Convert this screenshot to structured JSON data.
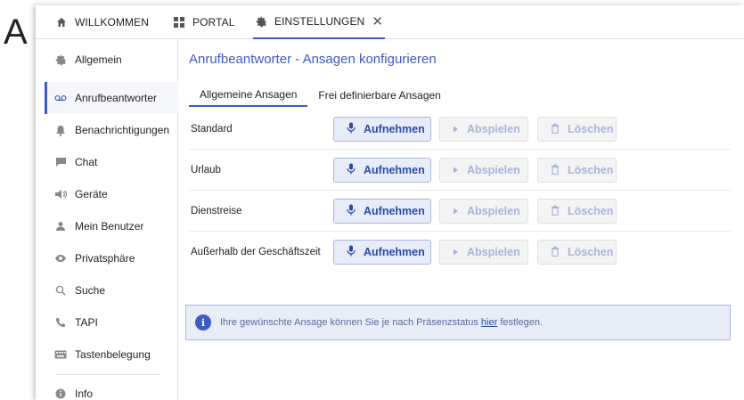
{
  "corner_letter": "A",
  "tabs": [
    {
      "label": "WILLKOMMEN",
      "icon": "home-icon"
    },
    {
      "label": "PORTAL",
      "icon": "grid-icon"
    },
    {
      "label": "EINSTELLUNGEN",
      "icon": "gear-icon",
      "active": true,
      "closable": true
    }
  ],
  "sidebar": {
    "items": [
      {
        "label": "Allgemein",
        "icon": "gear-icon"
      },
      {
        "label": "Anrufbeantworter",
        "icon": "voicemail-icon",
        "active": true
      },
      {
        "label": "Benachrichtigungen",
        "icon": "bell-icon"
      },
      {
        "label": "Chat",
        "icon": "chat-icon"
      },
      {
        "label": "Geräte",
        "icon": "speaker-icon"
      },
      {
        "label": "Mein Benutzer",
        "icon": "user-icon"
      },
      {
        "label": "Privatsphäre",
        "icon": "eye-icon"
      },
      {
        "label": "Suche",
        "icon": "search-icon"
      },
      {
        "label": "TAPI",
        "icon": "phone-icon"
      },
      {
        "label": "Tastenbelegung",
        "icon": "keyboard-icon"
      },
      {
        "label": "Info",
        "icon": "info-icon"
      }
    ]
  },
  "main": {
    "title": "Anrufbeantworter - Ansagen konfigurieren",
    "subtabs": [
      {
        "label": "Allgemeine Ansagen",
        "active": true
      },
      {
        "label": "Frei definierbare Ansagen"
      }
    ],
    "buttons": {
      "record": "Aufnehmen",
      "play": "Abspielen",
      "delete": "Löschen"
    },
    "rows": [
      {
        "label": "Standard"
      },
      {
        "label": "Urlaub"
      },
      {
        "label": "Dienstreise"
      },
      {
        "label": "Außerhalb der Geschäftszeit"
      }
    ],
    "info": {
      "text_before": "Ihre gewünschte Ansage können Sie je nach Präsenzstatus ",
      "link": "hier",
      "text_after": " festlegen."
    }
  },
  "colors": {
    "accent": "#3b5cc4",
    "info_bg": "#e9edf8",
    "disabled_text": "#a7b5d8"
  }
}
